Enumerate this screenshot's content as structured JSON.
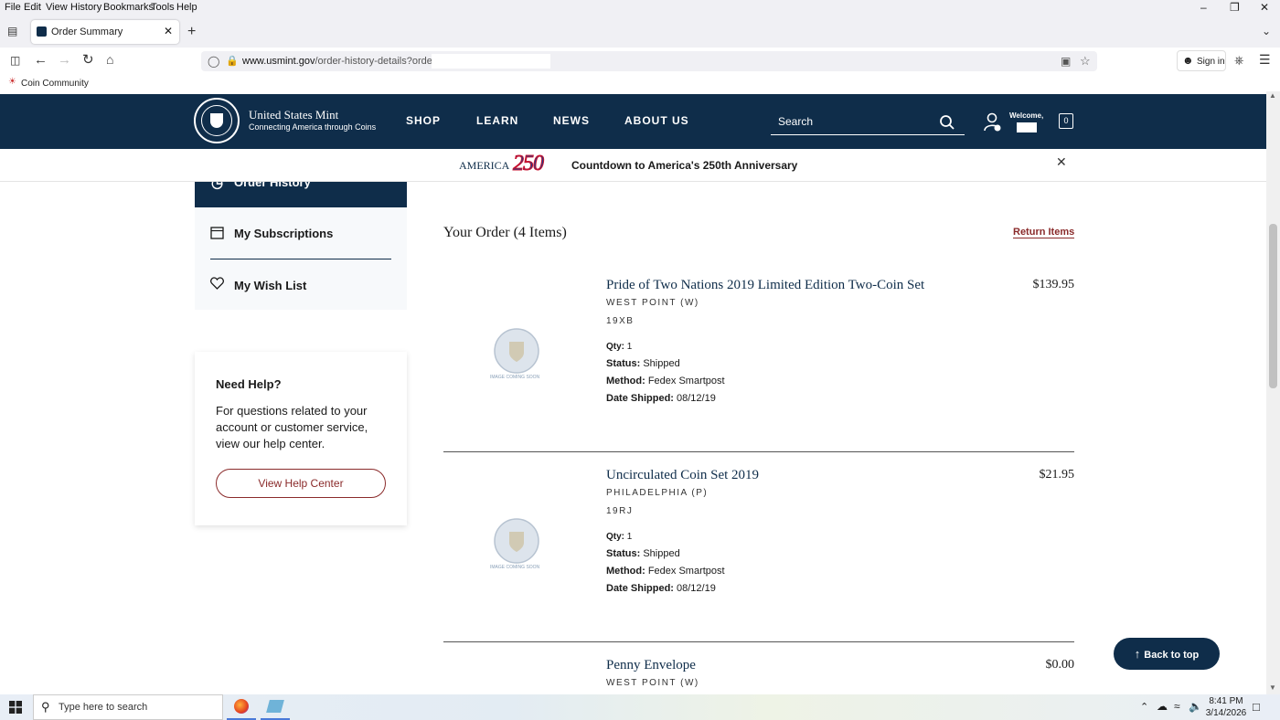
{
  "menubar": {
    "items": [
      "File",
      "Edit",
      "View",
      "History",
      "Bookmarks",
      "Tools",
      "Help"
    ]
  },
  "browser": {
    "tab_title": "Order Summary",
    "url_domain": "www.usmint.gov",
    "url_path": "/order-history-details?orderID",
    "sign_in": "Sign in",
    "bookmark": "Coin Community"
  },
  "header": {
    "brand_title": "United States Mint",
    "brand_subtitle": "Connecting America through Coins",
    "nav": [
      "SHOP",
      "LEARN",
      "NEWS",
      "ABOUT US"
    ],
    "search_placeholder": "Search",
    "welcome": "Welcome,",
    "cart_count": "0"
  },
  "banner": {
    "logo_word": "AMERICA",
    "logo_number": "250",
    "text": "Countdown to America's 250th Anniversary"
  },
  "sidebar": {
    "active_item": "Order History",
    "items": [
      "My Subscriptions",
      "My Wish List"
    ],
    "help_title": "Need Help?",
    "help_text": "For questions related to your account or customer service, view our help center.",
    "help_button": "View Help Center"
  },
  "order": {
    "title": "Your Order (4 Items)",
    "return_label": "Return Items",
    "labels": {
      "qty": "Qty:",
      "status": "Status:",
      "method": "Method:",
      "date": "Date Shipped:"
    },
    "items": [
      {
        "name": "Pride of Two Nations 2019 Limited Edition Two-Coin Set",
        "price": "$139.95",
        "mint": "WEST POINT (W)",
        "sku": "19XB",
        "qty": "1",
        "status": "Shipped",
        "method": "Fedex Smartpost",
        "date": "08/12/19",
        "image_caption": "IMAGE COMING SOON"
      },
      {
        "name": "Uncirculated Coin Set 2019",
        "price": "$21.95",
        "mint": "PHILADELPHIA (P)",
        "sku": "19RJ",
        "qty": "1",
        "status": "Shipped",
        "method": "Fedex Smartpost",
        "date": "08/12/19",
        "image_caption": "IMAGE COMING SOON"
      },
      {
        "name": "Penny Envelope",
        "price": "$0.00",
        "mint": "WEST POINT (W)"
      }
    ]
  },
  "back_to_top": "Back to top",
  "taskbar": {
    "search_placeholder": "Type here to search",
    "time": "8:41 PM",
    "date": "3/14/2026"
  },
  "colors": {
    "navy": "#0f2d4a",
    "accent_red": "#8a2a2a"
  }
}
